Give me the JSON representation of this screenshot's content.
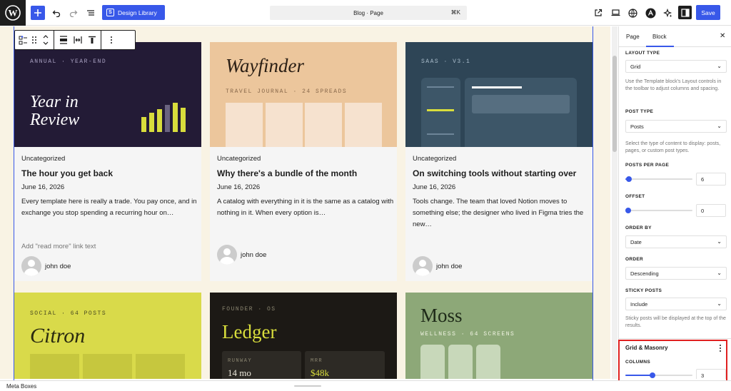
{
  "toolbar": {
    "design_library_label": "Design Library",
    "design_library_icon": "S",
    "command_label": "Blog · Page",
    "command_shortcut": "⌘K",
    "save_label": "Save"
  },
  "block_toolbar": {
    "items": [
      "grid-view-icon",
      "drag-handle-icon",
      "move-up-down-icon",
      "justify-stretch-icon",
      "justify-space-between-icon",
      "align-top-icon",
      "more-options-icon"
    ]
  },
  "posts": [
    {
      "thumb_label": "ANNUAL · YEAR-END",
      "thumb_title_1": "Year in",
      "thumb_title_2": "Review",
      "category": "Uncategorized",
      "title": "The hour you get back",
      "date": "June 16, 2026",
      "excerpt": "Every template here is really a trade. You pay once, and in exchange you stop spending a recurring hour on…",
      "read_more": "Add \"read more\" link text",
      "author": "john doe"
    },
    {
      "thumb_title": "Wayfinder",
      "thumb_label": "TRAVEL JOURNAL · 24 SPREADS",
      "category": "Uncategorized",
      "title": "Why there's a bundle of the month",
      "date": "June 16, 2026",
      "excerpt": "A catalog with everything in it is the same as a catalog with nothing in it. When every option is…",
      "author": "john doe"
    },
    {
      "thumb_label": "SAAS · V3.1",
      "category": "Uncategorized",
      "title": "On switching tools without starting over",
      "date": "June 16, 2026",
      "excerpt": "Tools change. The team that loved Notion moves to something else; the designer who lived in Figma tries the new…",
      "author": "john doe"
    },
    {
      "thumb_label": "SOCIAL · 64 POSTS",
      "thumb_title": "Citron"
    },
    {
      "thumb_label": "FOUNDER · OS",
      "thumb_title": "Ledger",
      "stat_1_label": "RUNWAY",
      "stat_1_value": "14 mo",
      "stat_2_label": "MRR",
      "stat_2_value": "$48k"
    },
    {
      "thumb_title": "Moss",
      "thumb_label": "WELLNESS · 64 SCREENS"
    }
  ],
  "sidebar": {
    "tab_page": "Page",
    "tab_block": "Block",
    "layout_type_label": "LAYOUT TYPE",
    "layout_type_value": "Grid",
    "layout_help": "Use the Template block's Layout controls in the toolbar to adjust columns and spacing.",
    "post_type_label": "POST TYPE",
    "post_type_value": "Posts",
    "post_type_help": "Select the type of content to display: posts, pages, or custom post types.",
    "posts_per_page_label": "POSTS PER PAGE",
    "posts_per_page_value": "6",
    "posts_per_page_fraction": 0.05,
    "offset_label": "OFFSET",
    "offset_value": "0",
    "offset_fraction": 0,
    "order_by_label": "ORDER BY",
    "order_by_value": "Date",
    "order_label": "ORDER",
    "order_value": "Descending",
    "sticky_label": "STICKY POSTS",
    "sticky_value": "Include",
    "sticky_help": "Sticky posts will be displayed at the top of the results.",
    "panel_title": "Grid & Masonry",
    "columns_label": "COLUMNS",
    "columns_value": "3",
    "columns_fraction": 0.4
  },
  "status_bar": {
    "label": "Meta Boxes"
  },
  "colors": {
    "accent": "#3858e9",
    "canvas_bg": "#f9f3e4",
    "highlight": "#e02020"
  }
}
